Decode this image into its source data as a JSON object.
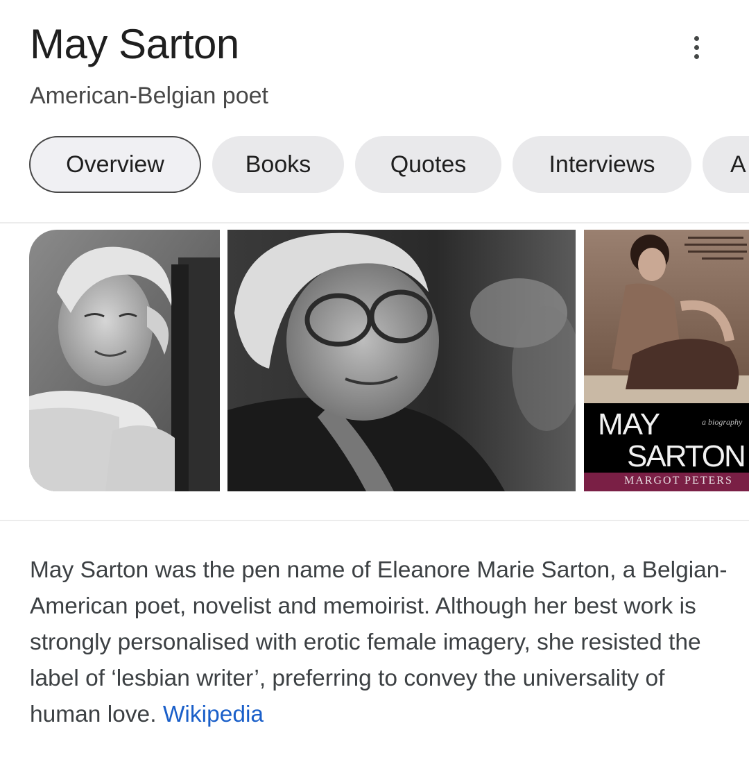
{
  "header": {
    "title": "May Sarton",
    "subtitle": "American-Belgian poet"
  },
  "menu_icon": "more-vert-icon",
  "tabs": [
    {
      "label": "Overview",
      "active": true
    },
    {
      "label": "Books",
      "active": false
    },
    {
      "label": "Quotes",
      "active": false
    },
    {
      "label": "Interviews",
      "active": false
    },
    {
      "label": "A",
      "active": false
    }
  ],
  "images": {
    "book_cover": {
      "title_line1": "MAY",
      "title_line2": "SARTON",
      "subtitle": "a biography",
      "author": "MARGOT PETERS"
    }
  },
  "description": {
    "text": "May Sarton was the pen name of Eleanore Marie Sarton, a Belgian-American poet, novelist and memoirist. Although her best work is strongly personalised with erotic female imagery, she resisted the label of ‘lesbian writer’, preferring to convey the universality of human love.",
    "source_link": "Wikipedia"
  },
  "colors": {
    "link": "#1a5fc9",
    "chip_bg": "#e9e9eb",
    "book_cover_band": "#7a1f45"
  }
}
